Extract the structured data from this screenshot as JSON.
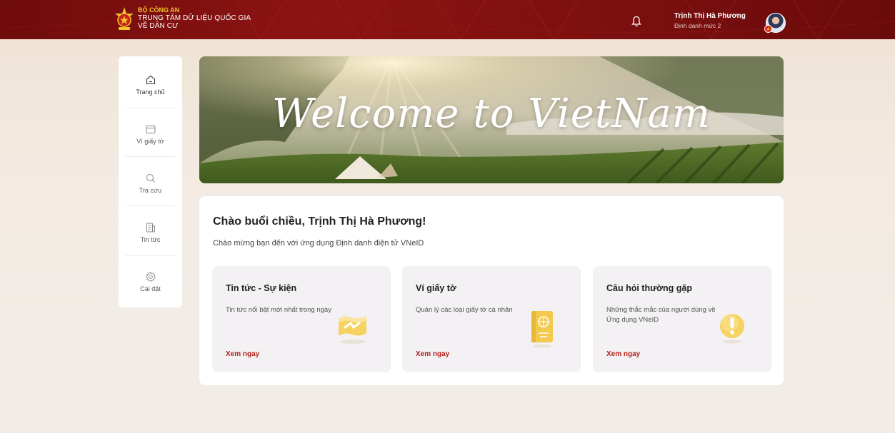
{
  "header": {
    "org_top": "BỘ CÔNG AN",
    "org_line1": "TRUNG TÂM DỮ LIỆU QUỐC GIA",
    "org_line2": "VỀ DÂN CƯ",
    "user_name": "Trịnh Thị Hà Phương",
    "user_level": "Định danh mức 2"
  },
  "sidebar": {
    "items": [
      {
        "label": "Trang chủ",
        "icon": "home-icon"
      },
      {
        "label": "Ví giấy tờ",
        "icon": "wallet-icon"
      },
      {
        "label": "Tra cứu",
        "icon": "search-icon"
      },
      {
        "label": "Tin tức",
        "icon": "news-icon"
      },
      {
        "label": "Cài đặt",
        "icon": "settings-icon"
      }
    ]
  },
  "banner": {
    "title": "Welcome to VietNam"
  },
  "main": {
    "greeting": "Chào buổi chiều, Trịnh Thị Hà Phương!",
    "subtitle": "Chào mừng bạn đến với ứng dụng Định danh điện tử VNeID",
    "features": [
      {
        "title": "Tin tức - Sự kiện",
        "desc": "Tin tức nổi bật mới nhất trong ngày",
        "link": "Xem ngay",
        "icon": "news-card-icon"
      },
      {
        "title": "Ví giấy tờ",
        "desc": "Quản lý các loại giấy tờ cá nhân",
        "link": "Xem ngay",
        "icon": "passport-icon"
      },
      {
        "title": "Câu hỏi thường gặp",
        "desc": "Những thắc mắc của người dùng về Ứng dụng VNeID",
        "link": "Xem ngay",
        "icon": "exclamation-icon"
      }
    ]
  },
  "colors": {
    "header": "#8d1313",
    "accent": "#b3231c",
    "gold": "#f3c22a"
  }
}
